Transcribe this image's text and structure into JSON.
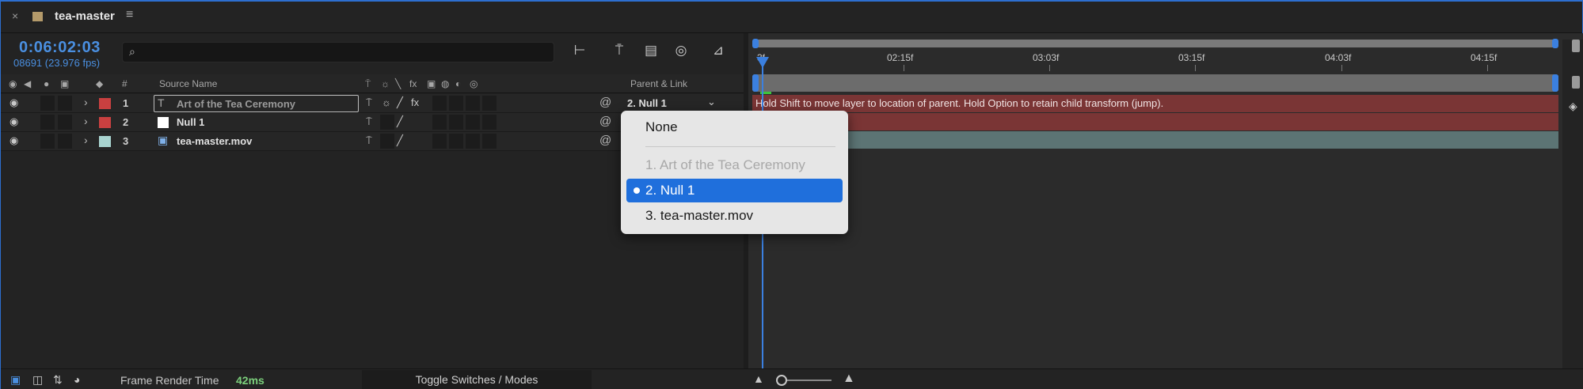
{
  "tab": {
    "close_glyph": "×",
    "title": "tea-master",
    "menu_glyph": "≡"
  },
  "panel": {
    "timecode": "0:06:02:03",
    "frame_readout": "08691 (23.976 fps)",
    "search_icon": "⌕",
    "search_placeholder": ""
  },
  "columns": {
    "num": "#",
    "source_name": "Source Name",
    "switches": [
      "⍑",
      "☼",
      "╲",
      "fx",
      "▣",
      "◍",
      "◐",
      "◎"
    ],
    "parent_link": "Parent & Link"
  },
  "layers": [
    {
      "num": "1",
      "name": "Art of the Tea  Ceremony",
      "type_icon": "T",
      "label_color": "#c94040",
      "parent": "2. Null 1",
      "renaming": true
    },
    {
      "num": "2",
      "name": "Null 1",
      "type_icon": "",
      "label_color": "#c94040",
      "parent": "",
      "renaming": false
    },
    {
      "num": "3",
      "name": "tea-master.mov",
      "type_icon": "▣",
      "label_color": "#a9d4d0",
      "parent": "",
      "renaming": false
    }
  ],
  "timeline": {
    "ruler": [
      "3f",
      "02:15f",
      "03:03f",
      "03:15f",
      "04:03f",
      "04:15f"
    ],
    "hint": "Hold Shift to move layer to location of parent. Hold Option to retain child transform (jump)."
  },
  "parent_menu": {
    "items": [
      {
        "label": "None",
        "state": "enabled"
      },
      {
        "label": "1. Art of the Tea  Ceremony",
        "state": "disabled"
      },
      {
        "label": "2. Null 1",
        "state": "selected"
      },
      {
        "label": "3. tea-master.mov",
        "state": "enabled"
      }
    ]
  },
  "bottom": {
    "frame_render_label": "Frame Render Time",
    "frame_render_value": "42ms",
    "toggle_label": "Toggle Switches / Modes"
  },
  "colors": {
    "accent": "#3b80e0",
    "layer_bar_red": "#7a3535",
    "layer_bar_teal": "#5c7474",
    "render_time_green": "#7cd07c"
  }
}
